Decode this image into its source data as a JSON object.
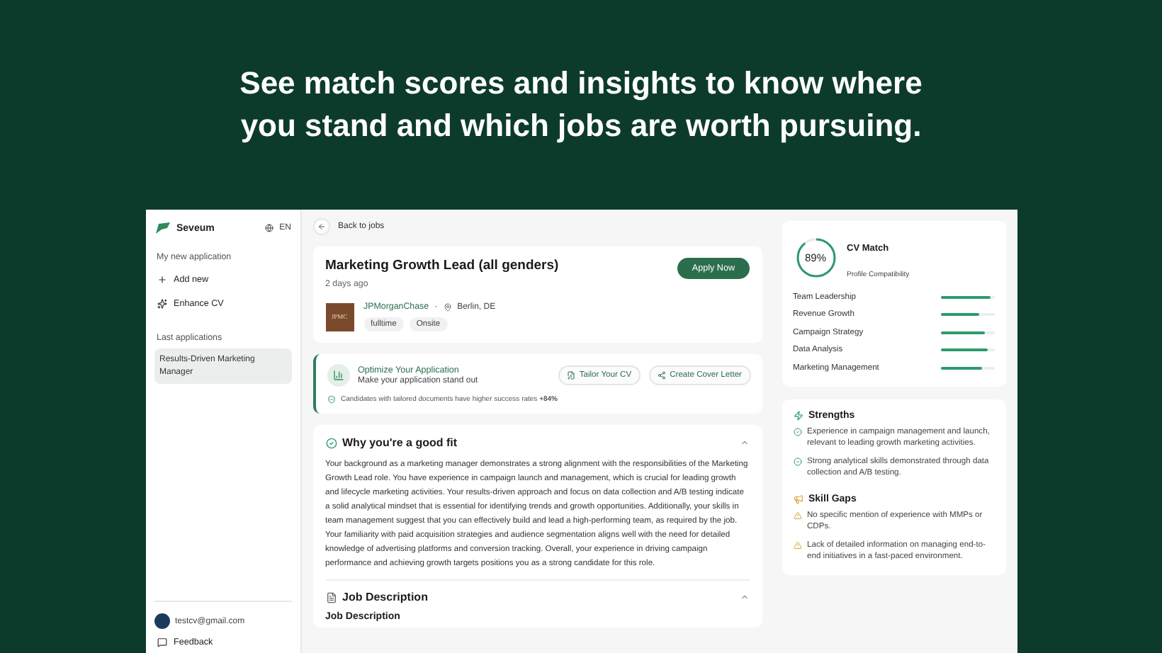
{
  "headline": "See match scores and insights to know where you stand and which jobs are worth pursuing.",
  "sidebar": {
    "brand": "Seveum",
    "language": "EN",
    "section_new": "My new application",
    "actions": [
      {
        "kind": "add",
        "label": "Add new"
      },
      {
        "kind": "enhance",
        "label": "Enhance CV"
      }
    ],
    "section_recent": "Last applications",
    "recent": [
      {
        "label": "Results-Driven Marketing Manager",
        "selected": true
      }
    ],
    "user_email": "testcv@gmail.com",
    "feedback": "Feedback"
  },
  "back_link": "Back to jobs",
  "job": {
    "title": "Marketing Growth Lead (all genders)",
    "posted": "2 days ago",
    "apply": "Apply Now",
    "logo": "JPMC",
    "company": "JPMorganChase",
    "separator": "·",
    "location": "Berlin, DE",
    "tags": [
      "fulltime",
      "Onsite"
    ]
  },
  "optimize": {
    "title": "Optimize Your Application",
    "subtitle": "Make your application stand out",
    "buttons": [
      {
        "kind": "tailor",
        "label": "Tailor Your CV"
      },
      {
        "kind": "cover",
        "label": "Create Cover Letter"
      }
    ],
    "note": "Candidates with tailored documents have higher success rates **+84%**"
  },
  "good_fit": {
    "title": "Why you're a good fit",
    "expanded": true,
    "text": "Your background as a marketing manager demonstrates a strong alignment with the responsibilities of the Marketing Growth Lead role. You have experience in campaign launch and management, which is crucial for leading growth and lifecycle marketing activities. Your results-driven approach and focus on data collection and A/B testing indicate a solid analytical mindset that is essential for identifying trends and growth opportunities. Additionally, your skills in team management suggest that you can effectively build and lead a high-performing team, as required by the job. Your familiarity with paid acquisition strategies and audience segmentation aligns well with the need for detailed knowledge of advertising platforms and conversion tracking. Overall, your experience in driving campaign performance and achieving growth targets positions you as a strong candidate for this role."
  },
  "job_description": {
    "title": "Job Description",
    "expanded": true,
    "subheading": "Job Description"
  },
  "match": {
    "score": "89%",
    "title": "CV Match",
    "subtitle": "Profile Compatibility",
    "skills": [
      {
        "name": "Team Leadership",
        "level": 0.93
      },
      {
        "name": "Revenue Growth",
        "level": 0.72
      },
      {
        "name": "Campaign Strategy",
        "level": 0.82
      },
      {
        "name": "Data Analysis",
        "level": 0.88
      },
      {
        "name": "Marketing Management",
        "level": 0.78
      }
    ]
  },
  "insights": [
    {
      "kind": "strength",
      "title": "Strengths",
      "items": [
        "Experience in campaign management and launch, relevant to leading growth marketing activities.",
        "Strong analytical skills demonstrated through data collection and A/B testing."
      ]
    },
    {
      "kind": "gap",
      "title": "Skill Gaps",
      "items": [
        "No specific mention of experience with MMPs or CDPs.",
        "Lack of detailed information on managing end-to-end initiatives in a fast-paced environment."
      ]
    }
  ]
}
